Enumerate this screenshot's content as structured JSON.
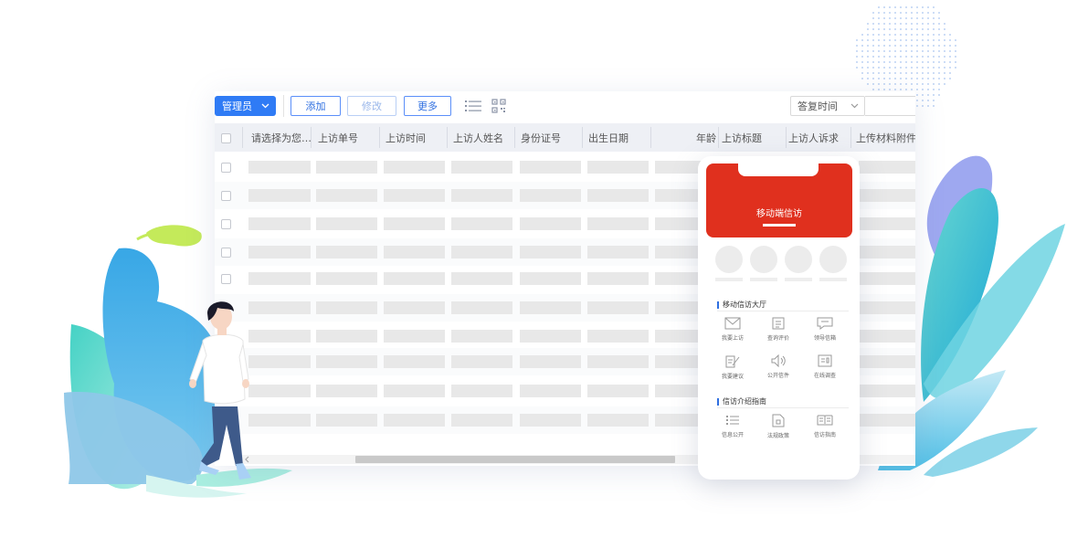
{
  "toolbar": {
    "role_label": "管理员",
    "add_label": "添加",
    "edit_label": "修改",
    "more_label": "更多",
    "sort_label": "答复时间"
  },
  "table": {
    "columns": [
      "请选择为您…",
      "上访单号",
      "上访时间",
      "上访人姓名",
      "身份证号",
      "出生日期",
      "年龄",
      "上访标题",
      "上访人诉求",
      "上传材料附件"
    ],
    "row_count": 10
  },
  "phone": {
    "banner_title": "移动端信访",
    "section1_title": "移动信访大厅",
    "section1_items": [
      {
        "label": "我要上访",
        "icon": "mail-icon"
      },
      {
        "label": "查询评价",
        "icon": "document-icon"
      },
      {
        "label": "领导信箱",
        "icon": "message-icon"
      },
      {
        "label": "我要建议",
        "icon": "edit-icon"
      },
      {
        "label": "公开信件",
        "icon": "speaker-icon"
      },
      {
        "label": "在线调查",
        "icon": "survey-icon"
      }
    ],
    "section2_title": "信访介绍指南",
    "section2_items": [
      {
        "label": "信息公开",
        "icon": "list-icon"
      },
      {
        "label": "法规政策",
        "icon": "file-icon"
      },
      {
        "label": "信访指南",
        "icon": "book-icon"
      }
    ]
  },
  "colors": {
    "accent": "#2f7bf5",
    "banner": "#e0301e",
    "placeholder": "#e8e8e8"
  }
}
